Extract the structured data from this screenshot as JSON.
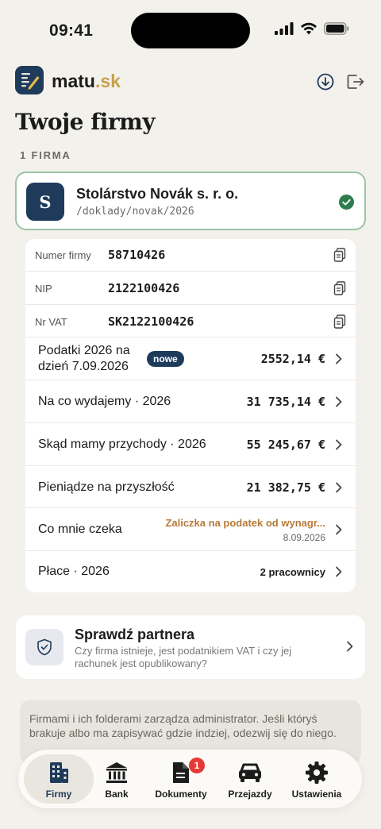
{
  "status_bar": {
    "time": "09:41"
  },
  "app": {
    "logo_name": "matu",
    "logo_tld": ".sk"
  },
  "page": {
    "title": "Twoje firmy",
    "section_label": "1 FIRMA"
  },
  "company": {
    "avatar_letter": "S",
    "name": "Stolárstvo Novák s. r. o.",
    "path": "/doklady/novak/2026"
  },
  "identifiers": [
    {
      "label": "Numer firmy",
      "value": "58710426"
    },
    {
      "label": "NIP",
      "value": "2122100426"
    },
    {
      "label": "Nr VAT",
      "value": "SK2122100426"
    }
  ],
  "rows": {
    "taxes": {
      "label_line1": "Podatki 2026 na",
      "label_line2": "dzień 7.09.2026",
      "badge": "nowe",
      "value": "2552,14 €"
    },
    "expenses": {
      "label": "Na co wydajemy · 2026",
      "value": "31 735,14 €"
    },
    "income": {
      "label": "Skąd mamy przychody · 2026",
      "value": "55 245,67 €"
    },
    "savings": {
      "label": "Pieniądze na przyszłość",
      "value": "21 382,75 €"
    },
    "upcoming": {
      "label": "Co mnie czeka",
      "title": "Zaliczka na podatek od wynagr...",
      "date": "8.09.2026"
    },
    "payroll": {
      "label": "Płace · 2026",
      "value": "2 pracownicy"
    }
  },
  "partner": {
    "title": "Sprawdź partnera",
    "description": "Czy firma istnieje, jest podatnikiem VAT i czy jej rachunek jest opublikowany?"
  },
  "admin_note": "Firmami i ich folderami zarządza administrator. Jeśli któryś brakuje albo ma zapisywać gdzie indziej, odezwij się do niego.",
  "bottom_nav": [
    {
      "label": "Firmy",
      "icon": "buildings-icon",
      "active": true
    },
    {
      "label": "Bank",
      "icon": "bank-icon"
    },
    {
      "label": "Dokumenty",
      "icon": "document-icon",
      "badge": "1"
    },
    {
      "label": "Przejazdy",
      "icon": "car-icon"
    },
    {
      "label": "Ustawienia",
      "icon": "gear-icon"
    }
  ],
  "colors": {
    "brand_navy": "#1f3b5c",
    "accent_gold": "#c8a24a",
    "success_green": "#2e7d4f",
    "warning_orange": "#b87a3a",
    "badge_red": "#e53935"
  }
}
